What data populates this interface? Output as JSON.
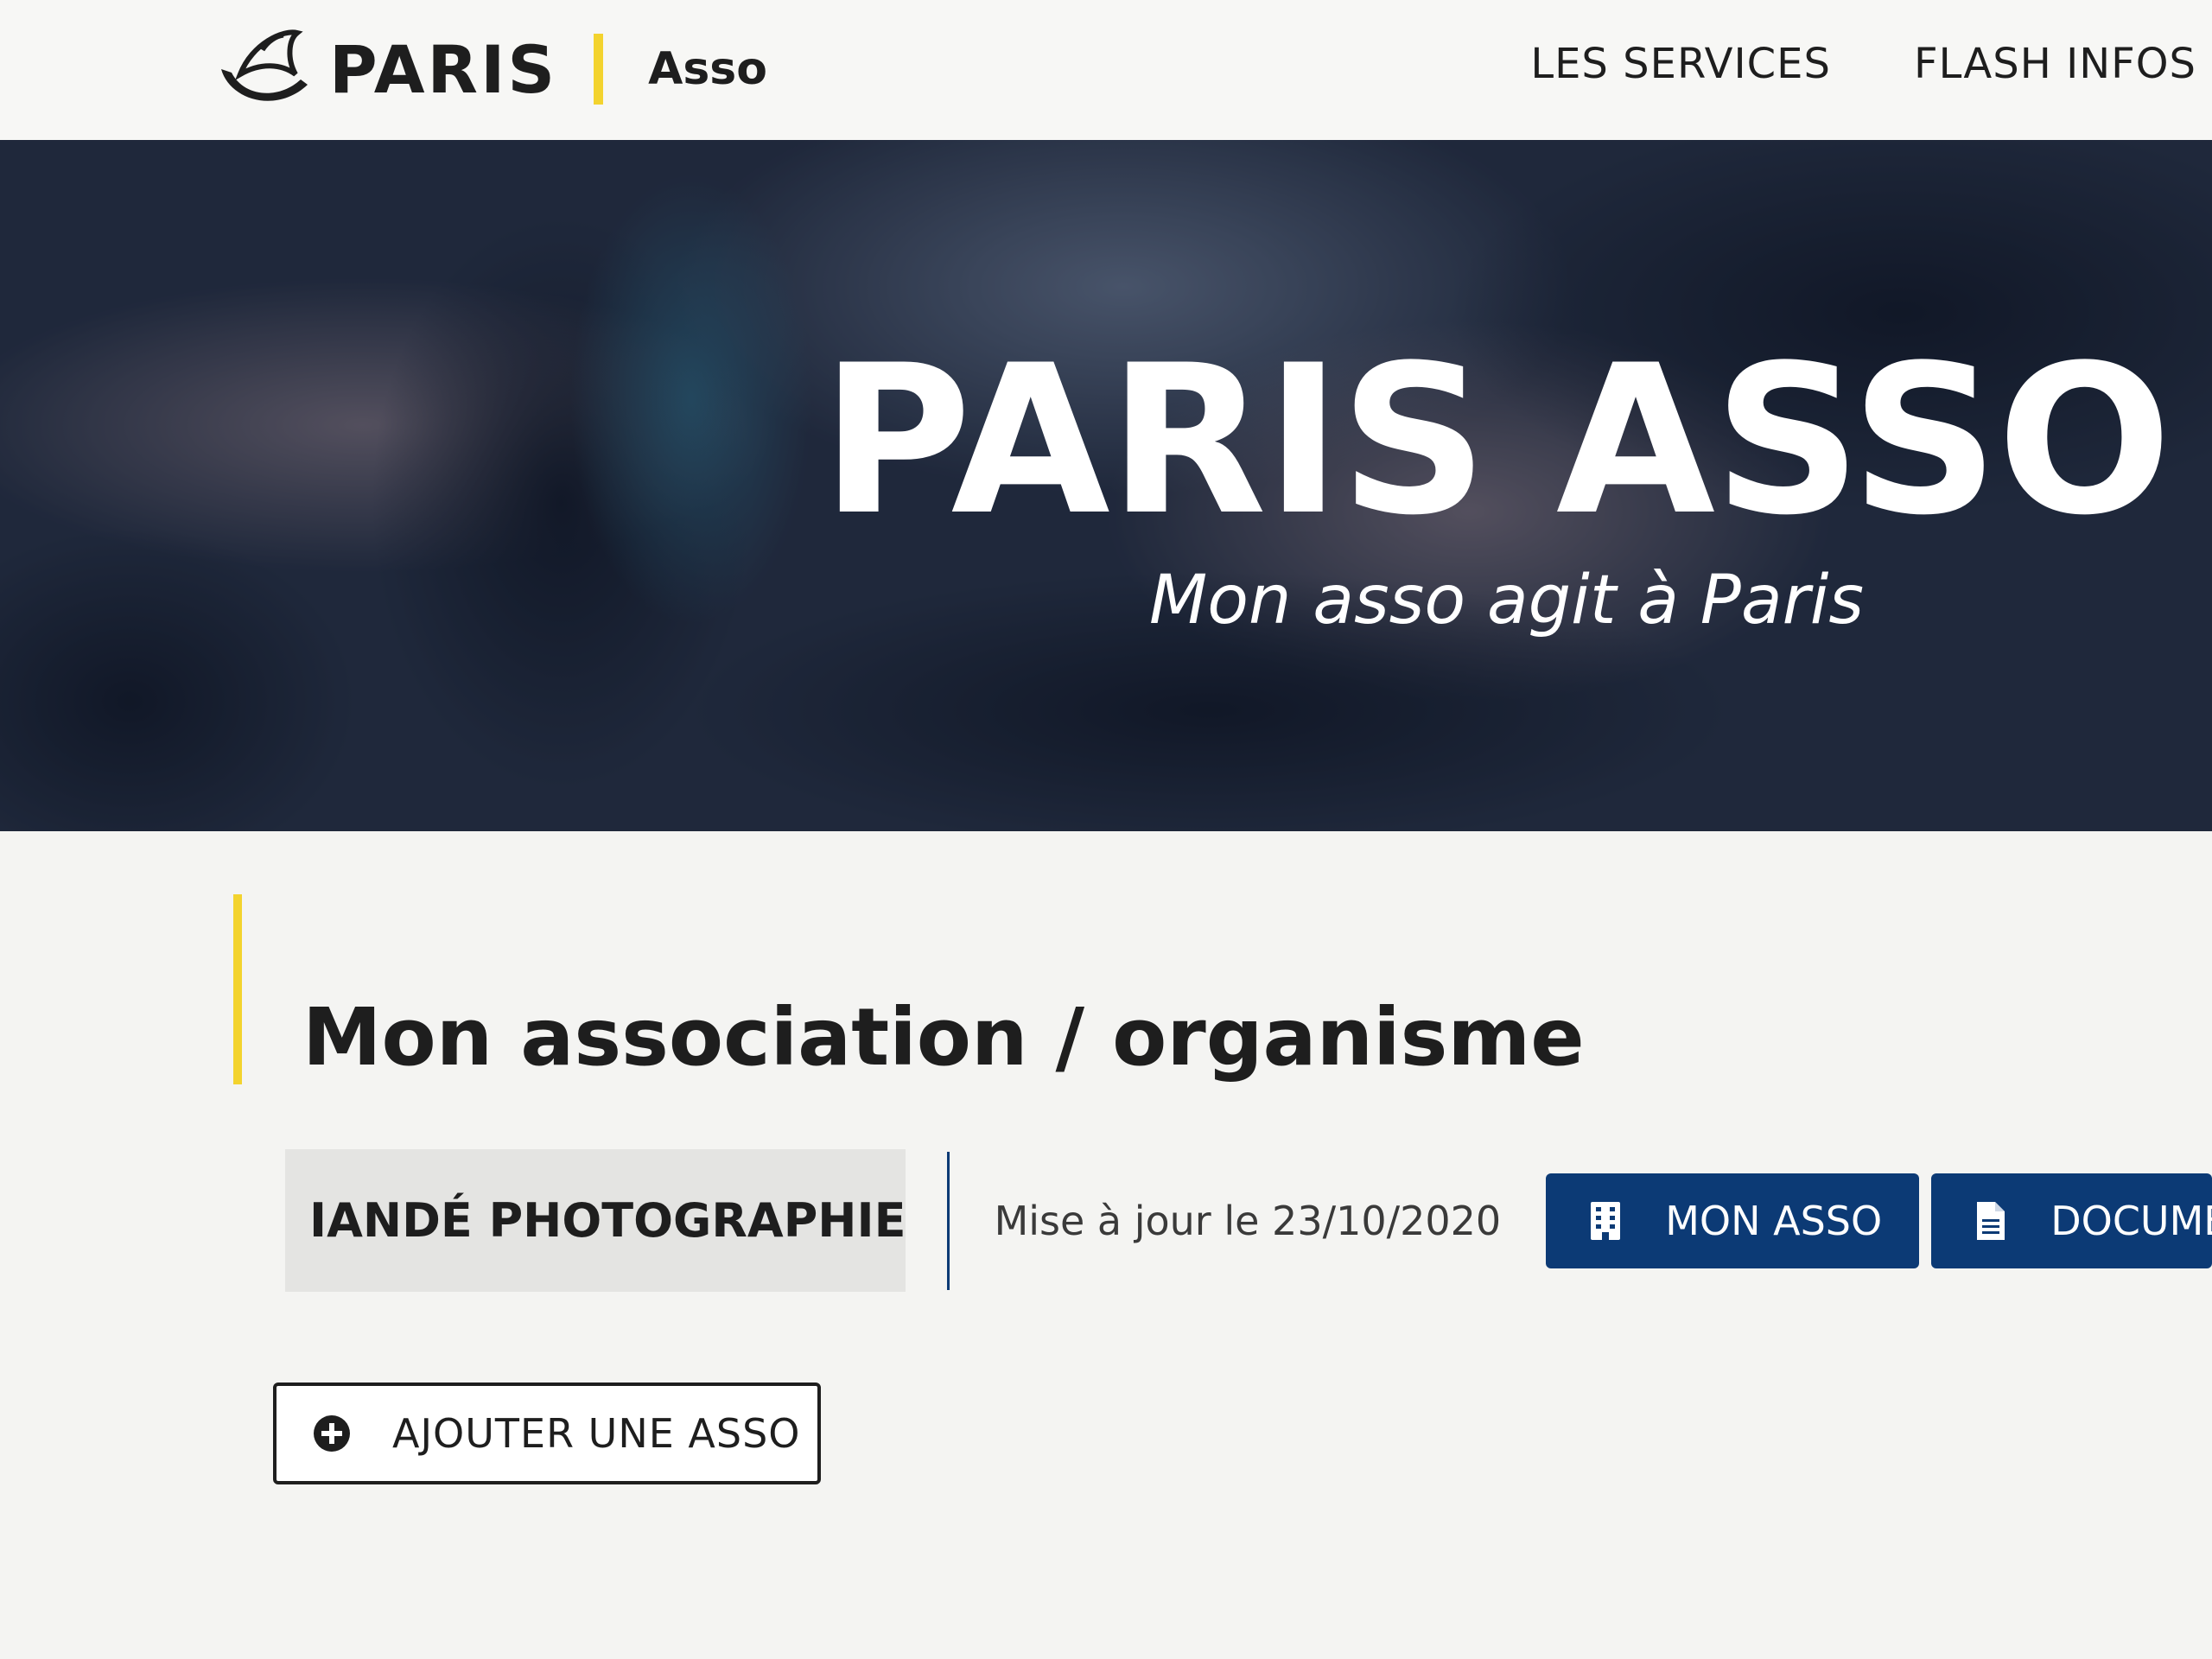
{
  "header": {
    "logo_text": "PARIS",
    "logo_sub": "Asso",
    "nav": [
      {
        "label": "LES SERVICES"
      },
      {
        "label": "FLASH INFOS"
      }
    ]
  },
  "hero": {
    "title": "PARIS ASSO",
    "subtitle": "Mon asso agit à Paris"
  },
  "main": {
    "section_title": "Mon association / organisme",
    "organization": {
      "name": "IANDÉ PHOTOGRAPHIE",
      "update_text": "Mise à jour le 23/10/2020"
    },
    "buttons": {
      "mon_asso": "MON ASSO",
      "documents": "DOCUMENTS",
      "add_asso": "AJOUTER UNE ASSO"
    }
  },
  "icons": {
    "logo": "paris-boat-icon",
    "mon_asso": "building-icon",
    "documents": "document-icon",
    "add": "plus-circle-icon"
  },
  "colors": {
    "primary": "#0c3a75",
    "accent": "#f3d32e",
    "text": "#1e1e1e",
    "background": "#f4f4f2"
  }
}
